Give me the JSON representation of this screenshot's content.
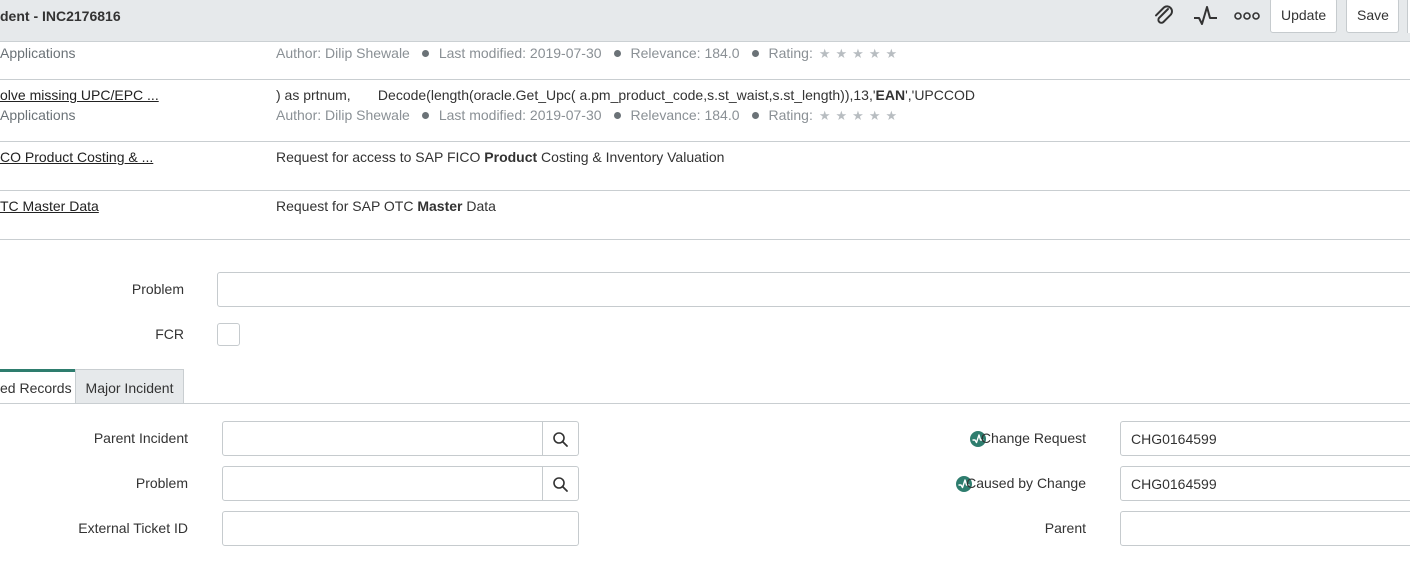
{
  "header": {
    "title": "dent - INC2176816",
    "icons": [
      "paperclip-icon",
      "activity-icon",
      "more-icon"
    ],
    "update_label": "Update",
    "save_label": "Save"
  },
  "kb_results": [
    {
      "link": "",
      "category": "Applications",
      "snippet": "",
      "author": "Author: Dilip Shewale",
      "modified": "Last modified: 2019-07-30",
      "relevance": "Relevance: 184.0",
      "rating": "Rating:"
    },
    {
      "link": "olve missing UPC/EPC ...",
      "category": "Applications",
      "snippet_pre": ") as prtnum,       Decode(length(oracle.Get_Upc( a.pm_product_code,s.st_waist,s.st_length)),13,'",
      "snippet_bold": "EAN",
      "snippet_post": "','UPCCOD",
      "author": "Author: Dilip Shewale",
      "modified": "Last modified: 2019-07-30",
      "relevance": "Relevance: 184.0",
      "rating": "Rating:"
    },
    {
      "link": "CO Product Costing & ...",
      "snippet_pre": "Request for access to SAP FICO ",
      "snippet_bold": "Product",
      "snippet_post": " Costing & Inventory Valuation"
    },
    {
      "link": "TC Master Data",
      "snippet_pre": "Request for SAP OTC ",
      "snippet_bold": "Master",
      "snippet_post": " Data"
    }
  ],
  "form": {
    "problem_label": "Problem",
    "problem_value": "",
    "fcr_label": "FCR"
  },
  "tabs": [
    {
      "label": "ed Records",
      "active": true
    },
    {
      "label": "Major Incident",
      "active": false
    }
  ],
  "related": {
    "parent_incident_label": "Parent Incident",
    "parent_incident_value": "",
    "problem_label": "Problem",
    "problem_value": "",
    "external_ticket_label": "External Ticket ID",
    "external_ticket_value": "",
    "change_request_label": "Change Request",
    "change_request_value": "CHG0164599",
    "caused_by_label": "Caused by Change",
    "caused_by_value": "CHG0164599",
    "parent_label": "Parent",
    "parent_value": ""
  },
  "colors": {
    "header_bg": "#e6e9eb",
    "tab_accent": "#2e7d6e",
    "border": "#c6cbce"
  }
}
